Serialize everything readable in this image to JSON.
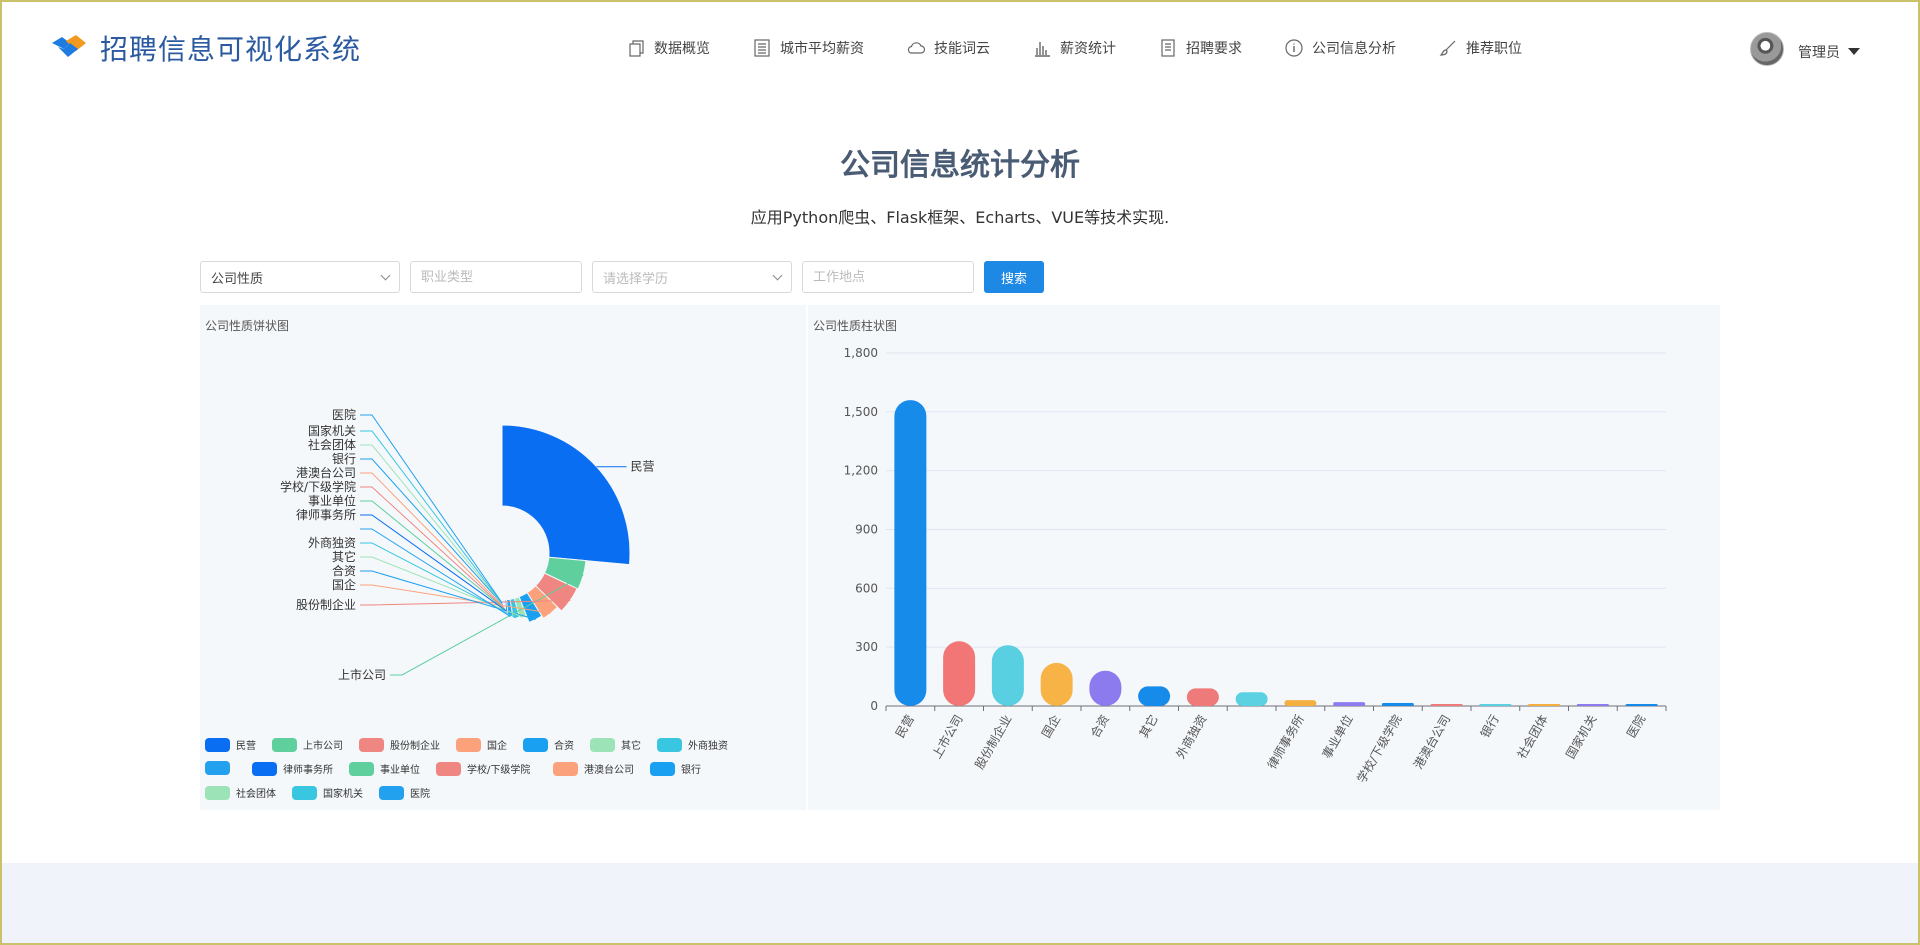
{
  "app": {
    "title": "招聘信息可视化系统"
  },
  "nav": [
    {
      "label": "数据概览",
      "icon": "copy-icon"
    },
    {
      "label": "城市平均薪资",
      "icon": "list-icon"
    },
    {
      "label": "技能词云",
      "icon": "cloud-icon"
    },
    {
      "label": "薪资统计",
      "icon": "bar-chart-icon"
    },
    {
      "label": "招聘要求",
      "icon": "document-icon"
    },
    {
      "label": "公司信息分析",
      "icon": "info-icon"
    },
    {
      "label": "推荐职位",
      "icon": "brush-icon"
    }
  ],
  "user": {
    "name": "管理员"
  },
  "page": {
    "title": "公司信息统计分析",
    "subtitle": "应用Python爬虫、Flask框架、Echarts、VUE等技术实现."
  },
  "filters": {
    "company_type": "公司性质",
    "job_type_placeholder": "职业类型",
    "education_placeholder": "请选择学历",
    "location_placeholder": "工作地点",
    "search_label": "搜索"
  },
  "colors": {
    "accent": "#1e88e5",
    "title": "#4a5b74",
    "palette": [
      "#0a6ef2",
      "#5fcf9e",
      "#ef8681",
      "#fba27c",
      "#1aa0f0",
      "#9de3b8",
      "#38c6e0",
      "#22a1ef"
    ]
  },
  "chart_data": [
    {
      "type": "pie",
      "title": "公司性质饼状图",
      "subtype": "rose-half-donut",
      "categories": [
        "民营",
        "上市公司",
        "股份制企业",
        "国企",
        "合资",
        "其它",
        "外商独资",
        "",
        "律师事务所",
        "事业单位",
        "学校/下级学院",
        "港澳台公司",
        "银行",
        "社会团体",
        "国家机关",
        "医院"
      ],
      "values": [
        1560,
        330,
        310,
        220,
        180,
        100,
        90,
        70,
        30,
        20,
        15,
        10,
        5,
        4,
        3,
        2
      ],
      "legend_position": "bottom"
    },
    {
      "type": "bar",
      "title": "公司性质柱状图",
      "categories": [
        "民营",
        "上市公司",
        "股份制企业",
        "国企",
        "合资",
        "其它",
        "外商独资",
        "",
        "律师事务所",
        "事业单位",
        "学校/下级学院",
        "港澳台公司",
        "银行",
        "社会团体",
        "国家机关",
        "医院"
      ],
      "values": [
        1560,
        330,
        310,
        220,
        180,
        100,
        90,
        70,
        30,
        20,
        15,
        10,
        5,
        4,
        3,
        2
      ],
      "bar_colors": [
        "#178bea",
        "#f27676",
        "#59d0e1",
        "#f7b346",
        "#8c7aef",
        "#178bea",
        "#ef7a7a",
        "#5bd1e1",
        "#f3b041",
        "#8e7bf0",
        "#178bea",
        "#ef7a7a",
        "#5bd1e1",
        "#f3b041",
        "#8e7bf0",
        "#178bea"
      ],
      "ylim": [
        0,
        1800
      ],
      "yticks": [
        "0",
        "300",
        "600",
        "900",
        "1,200",
        "1,500",
        "1,800"
      ],
      "grid": true
    }
  ]
}
